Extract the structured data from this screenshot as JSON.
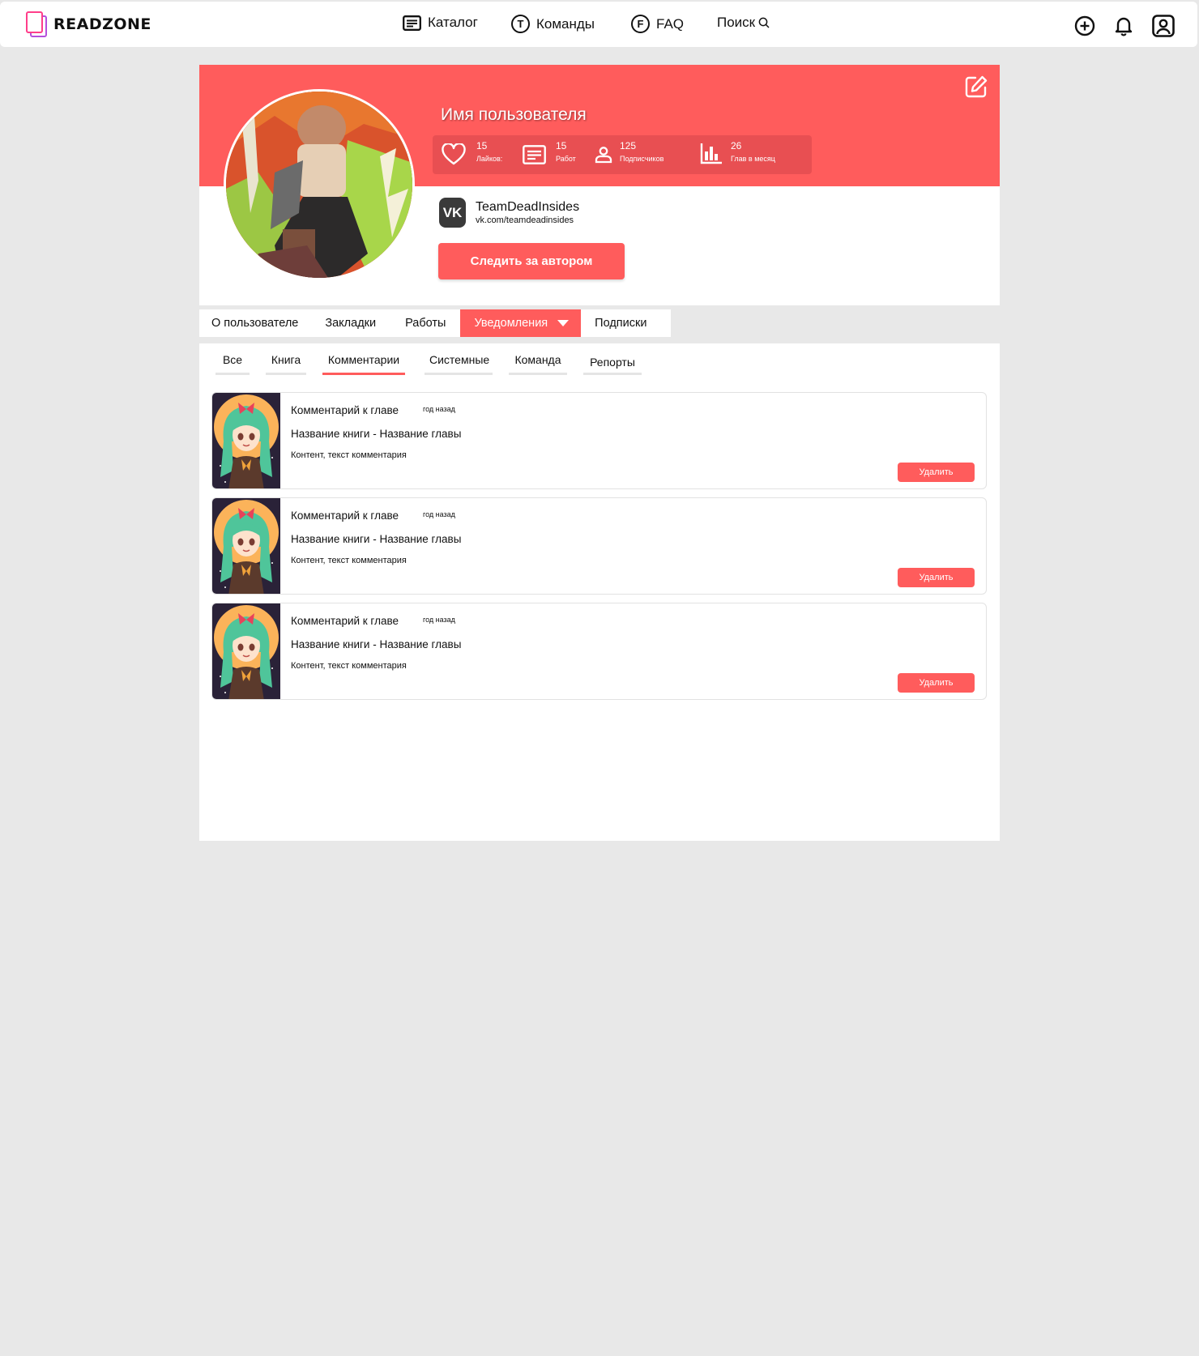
{
  "brand": {
    "name": "READZONE"
  },
  "nav": {
    "catalog": "Каталог",
    "teams": "Команды",
    "teams_letter": "T",
    "faq": "FAQ",
    "faq_letter": "F",
    "search": "Поиск"
  },
  "right_icons": [
    "plus-circle-icon",
    "bell-icon",
    "user-profile-icon"
  ],
  "profile": {
    "username": "Имя пользователя",
    "stats": [
      {
        "value": "15",
        "label": "Лайков:",
        "icon": "heart-icon"
      },
      {
        "value": "15",
        "label": "Работ",
        "icon": "list-icon"
      },
      {
        "value": "125",
        "label": "Подписчиков",
        "icon": "person-icon"
      },
      {
        "value": "26",
        "label": "Глав в месяц",
        "icon": "bar-chart-icon"
      }
    ],
    "social": {
      "icon_text": "VK",
      "name": "TeamDeadInsides",
      "url": "vk.com/teamdeadinsides"
    },
    "follow_label": "Следить за автором"
  },
  "tabs": [
    {
      "label": "О пользователе",
      "active": false
    },
    {
      "label": "Закладки",
      "active": false
    },
    {
      "label": "Работы",
      "active": false
    },
    {
      "label": "Уведомления",
      "active": true
    },
    {
      "label": "Подписки",
      "active": false
    }
  ],
  "subtabs": [
    {
      "label": "Все",
      "active": false
    },
    {
      "label": "Книга",
      "active": false
    },
    {
      "label": "Комментарии",
      "active": true
    },
    {
      "label": "Системные",
      "active": false
    },
    {
      "label": "Команда",
      "active": false
    },
    {
      "label": "Репорты",
      "active": false
    }
  ],
  "notifications": [
    {
      "type": "Комментарий к главе",
      "time": "год назад",
      "title": "Название книги - Название главы",
      "text": "Контент, текст комментария",
      "delete_label": "Удалить"
    },
    {
      "type": "Комментарий к главе",
      "time": "год назад",
      "title": "Название книги - Название главы",
      "text": "Контент, текст комментария",
      "delete_label": "Удалить"
    },
    {
      "type": "Комментарий к главе",
      "time": "год назад",
      "title": "Название книги - Название главы",
      "text": "Контент, текст комментария",
      "delete_label": "Удалить"
    }
  ],
  "colors": {
    "accent": "#ff5c5c",
    "stats_bg": "#e84f52",
    "page_bg": "#e8e8e8"
  }
}
